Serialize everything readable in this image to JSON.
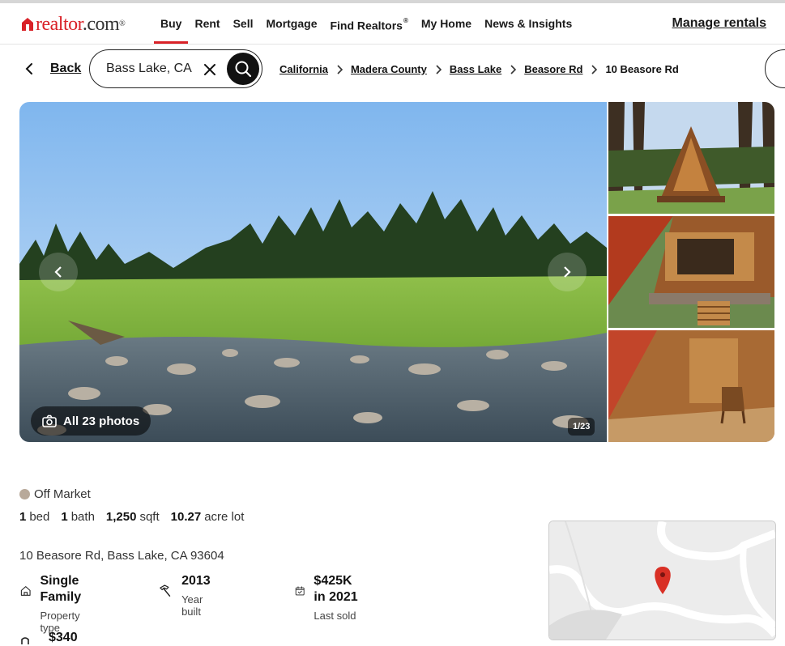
{
  "header": {
    "logo": {
      "brand": "realtor",
      "suffix": ".com",
      "mark": "®"
    },
    "nav": [
      "Buy",
      "Rent",
      "Sell",
      "Mortgage",
      "Find Realtors",
      "My Home",
      "News & Insights"
    ],
    "nav_active": "Buy",
    "find_realtors_mark": "®",
    "manage_rentals": "Manage rentals"
  },
  "subbar": {
    "back_label": "Back",
    "search_value": "Bass Lake, CA",
    "breadcrumbs": [
      "California",
      "Madera County",
      "Bass Lake",
      "Beasore Rd"
    ],
    "current": "10 Beasore Rd"
  },
  "gallery": {
    "all_photos_label": "All 23 photos",
    "counter": "1/23",
    "current_photo": 1,
    "total_photos": 23
  },
  "listing": {
    "status": "Off Market",
    "status_color": "#b8a99a",
    "beds": {
      "value": "1",
      "unit": "bed"
    },
    "baths": {
      "value": "1",
      "unit": "bath"
    },
    "sqft": {
      "value": "1,250",
      "unit": "sqft"
    },
    "lot": {
      "value": "10.27",
      "unit": "acre lot"
    },
    "address": "10 Beasore Rd, Bass Lake, CA 93604",
    "facts": [
      {
        "value": "Single Family",
        "label": "Property type",
        "icon": "house-icon"
      },
      {
        "value": "2013",
        "label": "Year built",
        "icon": "hammer-icon"
      },
      {
        "value": "$425K in 2021",
        "label": "Last sold",
        "icon": "calendar-check-icon"
      }
    ],
    "hoa_value": "$340"
  },
  "colors": {
    "brand_red": "#d92228",
    "map_pin": "#d93025"
  }
}
